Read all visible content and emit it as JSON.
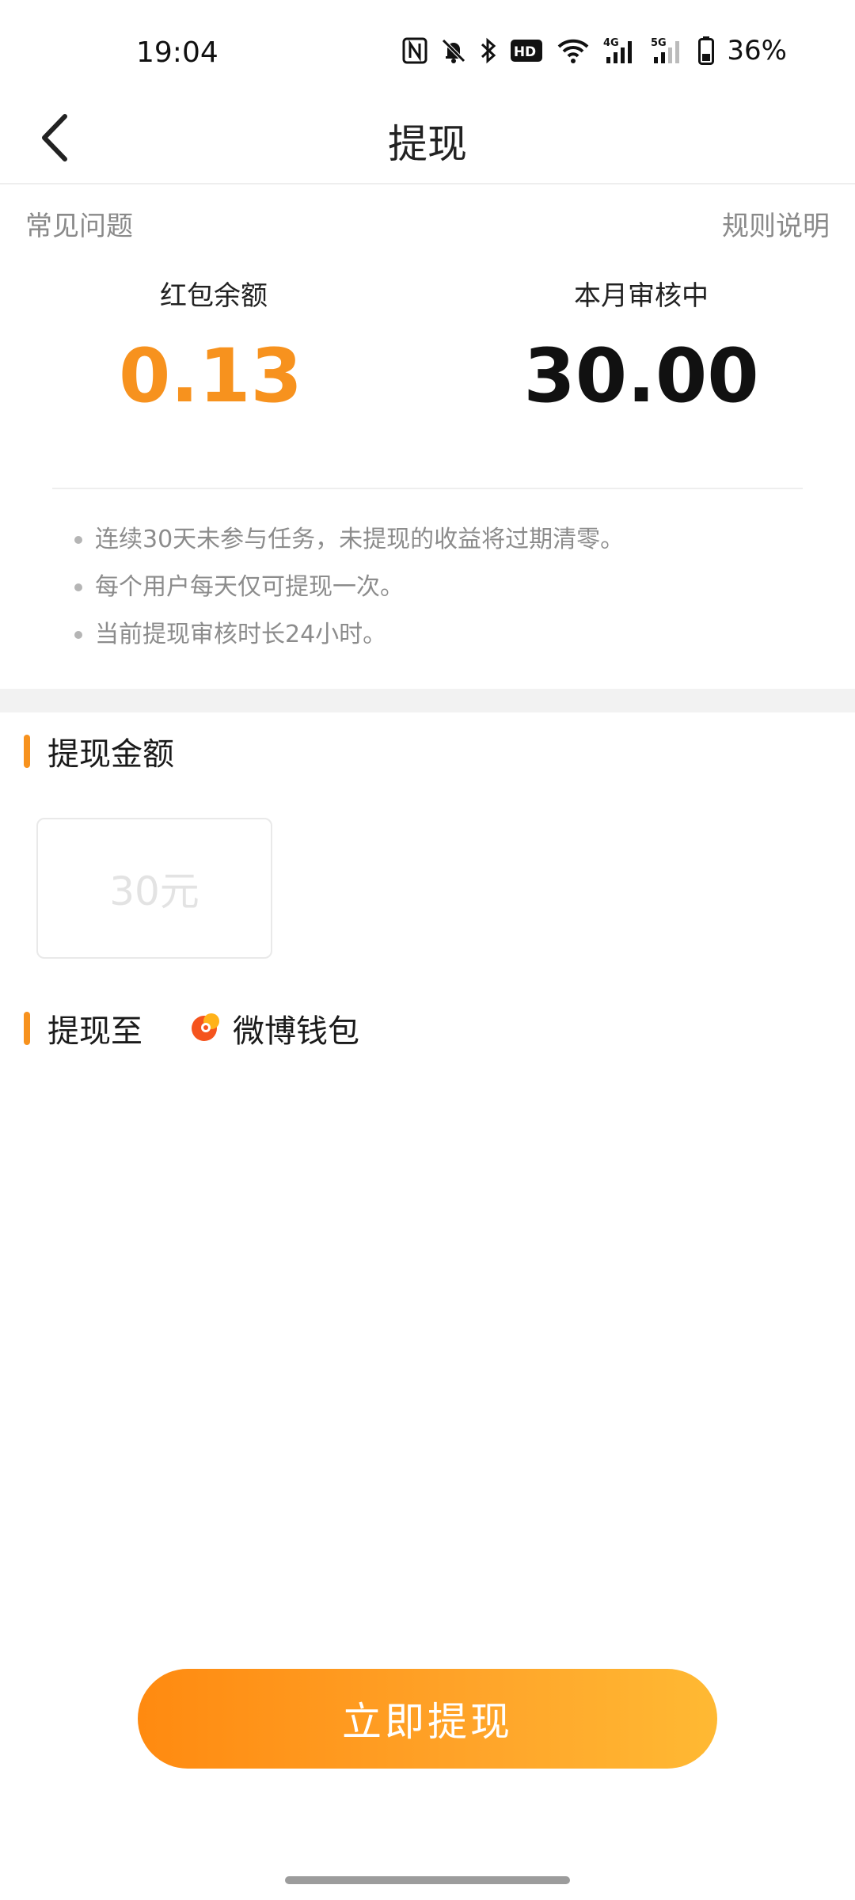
{
  "status_bar": {
    "time": "19:04",
    "battery": "36%",
    "icons": [
      "nfc-icon",
      "bell-muted-icon",
      "bluetooth-icon",
      "hd-icon",
      "wifi-icon",
      "signal-4g-icon",
      "signal-5g-icon",
      "battery-icon"
    ],
    "hd_label": "HD",
    "net_4g": "4G",
    "net_5g": "5G"
  },
  "header": {
    "title": "提现",
    "back_icon": "chevron-left-icon"
  },
  "links": {
    "faq": "常见问题",
    "rules": "规则说明"
  },
  "stats": {
    "balance_label": "红包余额",
    "balance_value": "0.13",
    "reviewing_label": "本月审核中",
    "reviewing_value": "30.00"
  },
  "notes": [
    "连续30天未参与任务，未提现的收益将过期清零。",
    "每个用户每天仅可提现一次。",
    "当前提现审核时长24小时。"
  ],
  "amount_section": {
    "title": "提现金额",
    "option": "30元"
  },
  "target_section": {
    "title": "提现至",
    "wallet_name": "微博钱包",
    "wallet_icon": "weibo-wallet-icon"
  },
  "actions": {
    "withdraw": "立即提现"
  },
  "colors": {
    "accent": "#f7921e",
    "button_start": "#ff8a10",
    "button_end": "#ffb933"
  }
}
